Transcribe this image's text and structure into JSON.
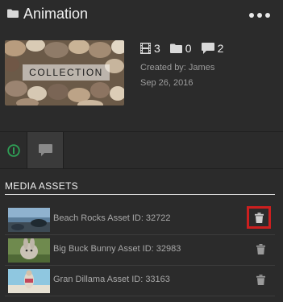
{
  "collection": {
    "title": "Animation",
    "thumb_label": "COLLECTION",
    "stats": {
      "videos": "3",
      "folders": "0",
      "comments": "2"
    },
    "created_by": "Created by: James",
    "date": "Sep 26, 2016"
  },
  "section": {
    "title": "MEDIA ASSETS"
  },
  "assets": [
    {
      "name": "Beach Rocks Asset ID: 32722"
    },
    {
      "name": "Big Buck Bunny Asset ID: 32983"
    },
    {
      "name": "Gran Dillama Asset ID: 33163"
    }
  ],
  "colors": {
    "background": "#2b2b2b",
    "info_tab_accent": "#2f9e55",
    "delete_highlight": "#cc1f1f"
  }
}
